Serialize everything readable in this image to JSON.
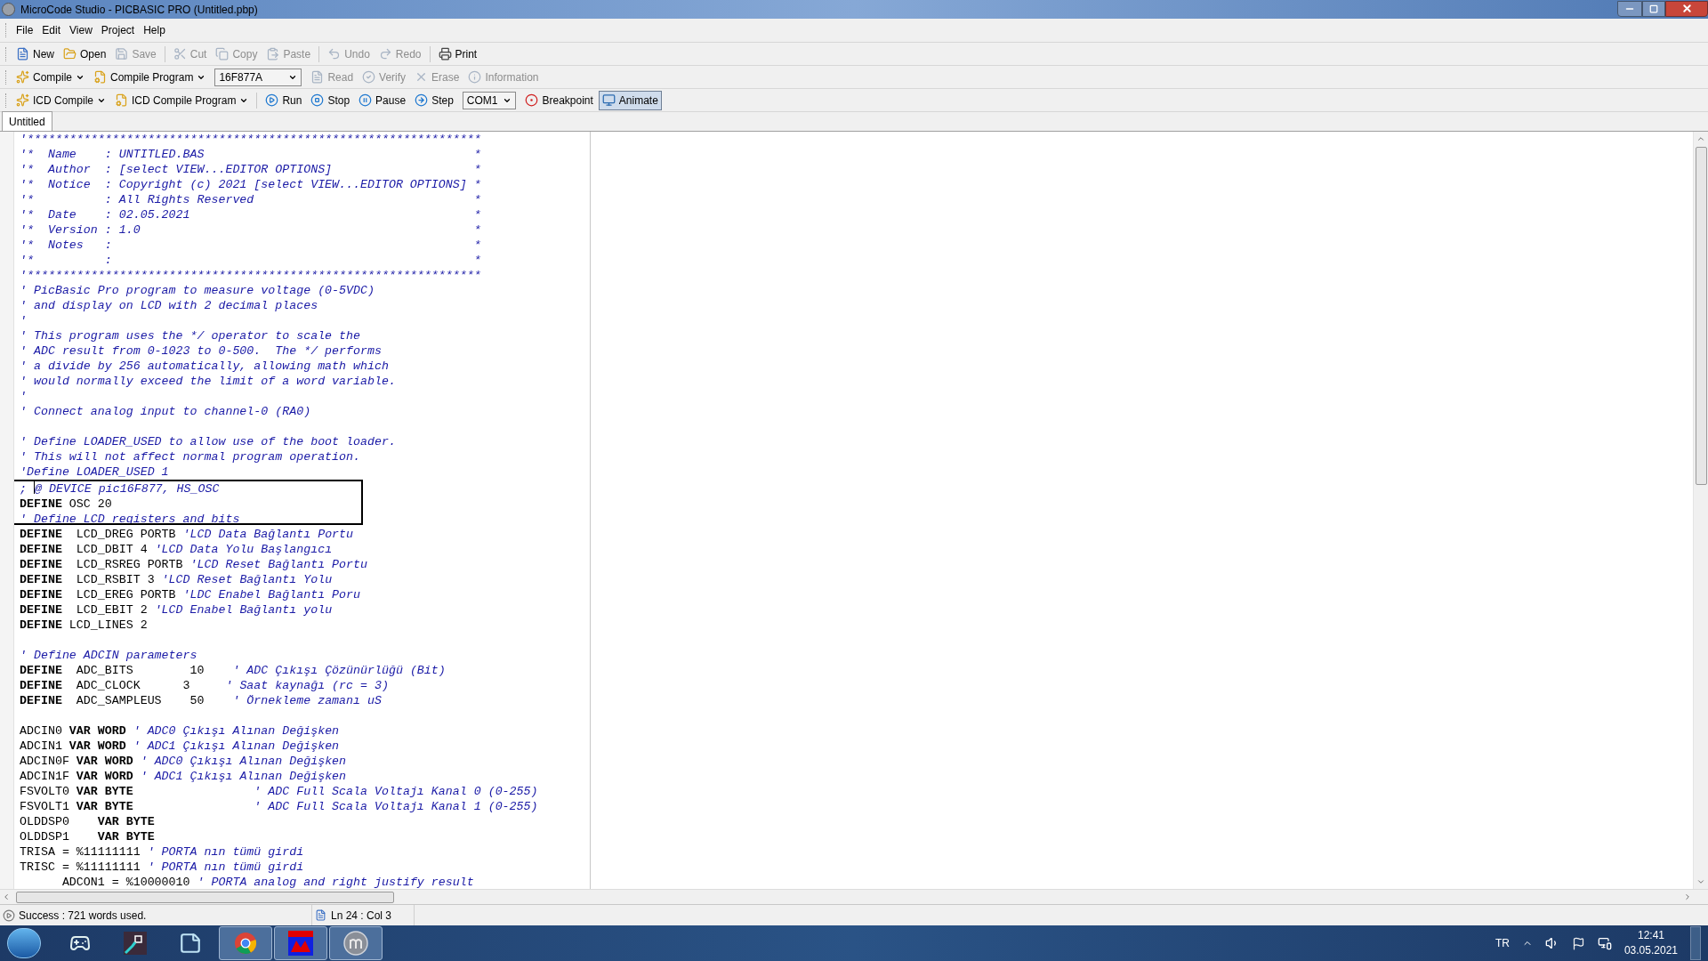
{
  "window": {
    "title": "MicroCode Studio - PICBASIC PRO (Untitled.pbp)"
  },
  "menu": [
    "File",
    "Edit",
    "View",
    "Project",
    "Help"
  ],
  "toolbar_standard": [
    {
      "kind": "button",
      "label": "New",
      "disabled": false
    },
    {
      "kind": "button",
      "label": "Open",
      "disabled": false
    },
    {
      "kind": "button",
      "label": "Save",
      "disabled": true
    },
    {
      "kind": "separator"
    },
    {
      "kind": "button",
      "label": "Cut",
      "disabled": true
    },
    {
      "kind": "button",
      "label": "Copy",
      "disabled": true
    },
    {
      "kind": "button",
      "label": "Paste",
      "disabled": true
    },
    {
      "kind": "separator"
    },
    {
      "kind": "button",
      "label": "Undo",
      "disabled": true
    },
    {
      "kind": "button",
      "label": "Redo",
      "disabled": true
    },
    {
      "kind": "separator"
    },
    {
      "kind": "button",
      "label": "Print",
      "disabled": false
    }
  ],
  "toolbar_compile": [
    {
      "kind": "button",
      "label": "Compile",
      "disabled": false,
      "dropdown": true
    },
    {
      "kind": "button",
      "label": "Compile Program",
      "disabled": false,
      "dropdown": true
    },
    {
      "kind": "combo",
      "value": "16F877A"
    },
    {
      "kind": "button",
      "label": "Read",
      "disabled": true,
      "dropdown": false
    },
    {
      "kind": "button",
      "label": "Verify",
      "disabled": true,
      "dropdown": false
    },
    {
      "kind": "button",
      "label": "Erase",
      "disabled": true,
      "dropdown": false
    },
    {
      "kind": "button",
      "label": "Information",
      "disabled": true,
      "dropdown": false
    }
  ],
  "toolbar_icd": [
    {
      "kind": "button",
      "label": "ICD Compile",
      "dropdown": true,
      "pressed": false
    },
    {
      "kind": "button",
      "label": "ICD Compile Program",
      "dropdown": true,
      "pressed": false
    },
    {
      "kind": "separator"
    },
    {
      "kind": "button",
      "label": "Run",
      "dropdown": false,
      "pressed": false
    },
    {
      "kind": "button",
      "label": "Stop",
      "dropdown": false,
      "pressed": false
    },
    {
      "kind": "button",
      "label": "Pause",
      "dropdown": false,
      "pressed": false
    },
    {
      "kind": "button",
      "label": "Step",
      "dropdown": false,
      "pressed": false
    },
    {
      "kind": "combo",
      "value": "COM1"
    },
    {
      "kind": "button",
      "label": "Breakpoint",
      "dropdown": false,
      "pressed": false
    },
    {
      "kind": "button",
      "label": "Animate",
      "dropdown": false,
      "pressed": true
    }
  ],
  "tabs": [
    {
      "label": "Untitled",
      "selected": true
    }
  ],
  "editor": {
    "lines": [
      {
        "kind": "code",
        "segments": [
          {
            "kind": "comment",
            "text": "'****************************************************************"
          }
        ]
      },
      {
        "kind": "code",
        "segments": [
          {
            "kind": "comment",
            "text": "'*  Name    : UNTITLED.BAS                                      *"
          }
        ]
      },
      {
        "kind": "code",
        "segments": [
          {
            "kind": "comment",
            "text": "'*  Author  : [select VIEW...EDITOR OPTIONS]                    *"
          }
        ]
      },
      {
        "kind": "code",
        "segments": [
          {
            "kind": "comment",
            "text": "'*  Notice  : Copyright (c) 2021 [select VIEW...EDITOR OPTIONS] *"
          }
        ]
      },
      {
        "kind": "code",
        "segments": [
          {
            "kind": "comment",
            "text": "'*          : All Rights Reserved                               *"
          }
        ]
      },
      {
        "kind": "code",
        "segments": [
          {
            "kind": "comment",
            "text": "'*  Date    : 02.05.2021                                        *"
          }
        ]
      },
      {
        "kind": "code",
        "segments": [
          {
            "kind": "comment",
            "text": "'*  Version : 1.0                                               *"
          }
        ]
      },
      {
        "kind": "code",
        "segments": [
          {
            "kind": "comment",
            "text": "'*  Notes   :                                                   *"
          }
        ]
      },
      {
        "kind": "code",
        "segments": [
          {
            "kind": "comment",
            "text": "'*          :                                                   *"
          }
        ]
      },
      {
        "kind": "code",
        "segments": [
          {
            "kind": "comment",
            "text": "'****************************************************************"
          }
        ]
      },
      {
        "kind": "code",
        "segments": [
          {
            "kind": "comment",
            "text": "' PicBasic Pro program to measure voltage (0-5VDC)"
          }
        ]
      },
      {
        "kind": "code",
        "segments": [
          {
            "kind": "comment",
            "text": "' and display on LCD with 2 decimal places"
          }
        ]
      },
      {
        "kind": "code",
        "segments": [
          {
            "kind": "comment",
            "text": "'"
          }
        ]
      },
      {
        "kind": "code",
        "segments": [
          {
            "kind": "comment",
            "text": "' This program uses the */ operator to scale the"
          }
        ]
      },
      {
        "kind": "code",
        "segments": [
          {
            "kind": "comment",
            "text": "' ADC result from 0-1023 to 0-500.  The */ performs"
          }
        ]
      },
      {
        "kind": "code",
        "segments": [
          {
            "kind": "comment",
            "text": "' a divide by 256 automatically, allowing math which"
          }
        ]
      },
      {
        "kind": "code",
        "segments": [
          {
            "kind": "comment",
            "text": "' would normally exceed the limit of a word variable."
          }
        ]
      },
      {
        "kind": "code",
        "segments": [
          {
            "kind": "comment",
            "text": "'"
          }
        ]
      },
      {
        "kind": "code",
        "segments": [
          {
            "kind": "comment",
            "text": "' Connect analog input to channel-0 (RA0)"
          }
        ]
      },
      {
        "kind": "blank"
      },
      {
        "kind": "code",
        "segments": [
          {
            "kind": "comment",
            "text": "' Define LOADER_USED to allow use of the boot loader."
          }
        ]
      },
      {
        "kind": "code",
        "segments": [
          {
            "kind": "comment",
            "text": "' This will not affect normal program operation."
          }
        ]
      },
      {
        "kind": "code",
        "segments": [
          {
            "kind": "comment",
            "text": "'Define LOADER_USED 1"
          }
        ]
      },
      {
        "kind": "code",
        "segments": [
          {
            "kind": "comment",
            "text": "; "
          },
          {
            "kind": "cursor"
          },
          {
            "kind": "comment",
            "text": "@ DEVICE pic16F877, HS_OSC"
          }
        ]
      },
      {
        "kind": "code",
        "segments": [
          {
            "kind": "keyword",
            "text": "DEFINE"
          },
          {
            "kind": "plain",
            "text": " OSC 20"
          }
        ]
      },
      {
        "kind": "code",
        "segments": [
          {
            "kind": "comment",
            "text": "' Define LCD registers and bits"
          }
        ]
      },
      {
        "kind": "code",
        "segments": [
          {
            "kind": "keyword",
            "text": "DEFINE"
          },
          {
            "kind": "plain",
            "text": "  LCD_DREG PORTB "
          },
          {
            "kind": "comment",
            "text": "'LCD Data Bağlantı Portu"
          }
        ]
      },
      {
        "kind": "code",
        "segments": [
          {
            "kind": "keyword",
            "text": "DEFINE"
          },
          {
            "kind": "plain",
            "text": "  LCD_DBIT 4 "
          },
          {
            "kind": "comment",
            "text": "'LCD Data Yolu Başlangıcı"
          }
        ]
      },
      {
        "kind": "code",
        "segments": [
          {
            "kind": "keyword",
            "text": "DEFINE"
          },
          {
            "kind": "plain",
            "text": "  LCD_RSREG PORTB "
          },
          {
            "kind": "comment",
            "text": "'LCD Reset Bağlantı Portu"
          }
        ]
      },
      {
        "kind": "code",
        "segments": [
          {
            "kind": "keyword",
            "text": "DEFINE"
          },
          {
            "kind": "plain",
            "text": "  LCD_RSBIT 3 "
          },
          {
            "kind": "comment",
            "text": "'LCD Reset Bağlantı Yolu"
          }
        ]
      },
      {
        "kind": "code",
        "segments": [
          {
            "kind": "keyword",
            "text": "DEFINE"
          },
          {
            "kind": "plain",
            "text": "  LCD_EREG PORTB "
          },
          {
            "kind": "comment",
            "text": "'LDC Enabel Bağlantı Poru"
          }
        ]
      },
      {
        "kind": "code",
        "segments": [
          {
            "kind": "keyword",
            "text": "DEFINE"
          },
          {
            "kind": "plain",
            "text": "  LCD_EBIT 2 "
          },
          {
            "kind": "comment",
            "text": "'LCD Enabel Bağlantı yolu"
          }
        ]
      },
      {
        "kind": "code",
        "segments": [
          {
            "kind": "keyword",
            "text": "DEFINE"
          },
          {
            "kind": "plain",
            "text": " LCD_LINES 2"
          }
        ]
      },
      {
        "kind": "blank"
      },
      {
        "kind": "code",
        "segments": [
          {
            "kind": "comment",
            "text": "' Define ADCIN parameters"
          }
        ]
      },
      {
        "kind": "code",
        "segments": [
          {
            "kind": "keyword",
            "text": "DEFINE"
          },
          {
            "kind": "plain",
            "text": "  ADC_BITS        10    "
          },
          {
            "kind": "comment",
            "text": "' ADC Çıkışı Çözünürlüğü (Bit)"
          }
        ]
      },
      {
        "kind": "code",
        "segments": [
          {
            "kind": "keyword",
            "text": "DEFINE"
          },
          {
            "kind": "plain",
            "text": "  ADC_CLOCK      3     "
          },
          {
            "kind": "comment",
            "text": "' Saat kaynağı (rc = 3)"
          }
        ]
      },
      {
        "kind": "code",
        "segments": [
          {
            "kind": "keyword",
            "text": "DEFINE"
          },
          {
            "kind": "plain",
            "text": "  ADC_SAMPLEUS    50    "
          },
          {
            "kind": "comment",
            "text": "' Örnekleme zamanı uS"
          }
        ]
      },
      {
        "kind": "blank"
      },
      {
        "kind": "code",
        "segments": [
          {
            "kind": "plain",
            "text": "ADCIN0 "
          },
          {
            "kind": "keyword",
            "text": "VAR WORD"
          },
          {
            "kind": "comment",
            "text": " ' ADC0 Çıkışı Alınan Değişken"
          }
        ]
      },
      {
        "kind": "code",
        "segments": [
          {
            "kind": "plain",
            "text": "ADCIN1 "
          },
          {
            "kind": "keyword",
            "text": "VAR WORD"
          },
          {
            "kind": "comment",
            "text": " ' ADC1 Çıkışı Alınan Değişken"
          }
        ]
      },
      {
        "kind": "code",
        "segments": [
          {
            "kind": "plain",
            "text": "ADCIN0F "
          },
          {
            "kind": "keyword",
            "text": "VAR WORD"
          },
          {
            "kind": "comment",
            "text": " ' ADC0 Çıkışı Alınan Değişken"
          }
        ]
      },
      {
        "kind": "code",
        "segments": [
          {
            "kind": "plain",
            "text": "ADCIN1F "
          },
          {
            "kind": "keyword",
            "text": "VAR WORD"
          },
          {
            "kind": "comment",
            "text": " ' ADC1 Çıkışı Alınan Değişken"
          }
        ]
      },
      {
        "kind": "code",
        "segments": [
          {
            "kind": "plain",
            "text": "FSVOLT0 "
          },
          {
            "kind": "keyword",
            "text": "VAR BYTE"
          },
          {
            "kind": "comment",
            "text": "                 ' ADC Full Scala Voltajı Kanal 0 (0-255)"
          }
        ]
      },
      {
        "kind": "code",
        "segments": [
          {
            "kind": "plain",
            "text": "FSVOLT1 "
          },
          {
            "kind": "keyword",
            "text": "VAR BYTE"
          },
          {
            "kind": "comment",
            "text": "                 ' ADC Full Scala Voltajı Kanal 1 (0-255)"
          }
        ]
      },
      {
        "kind": "code",
        "segments": [
          {
            "kind": "plain",
            "text": "OLDDSP0    "
          },
          {
            "kind": "keyword",
            "text": "VAR BYTE"
          }
        ]
      },
      {
        "kind": "code",
        "segments": [
          {
            "kind": "plain",
            "text": "OLDDSP1    "
          },
          {
            "kind": "keyword",
            "text": "VAR BYTE"
          }
        ]
      },
      {
        "kind": "code",
        "segments": [
          {
            "kind": "plain",
            "text": "TRISA = %11111111 "
          },
          {
            "kind": "comment",
            "text": "' PORTA nın tümü girdi"
          }
        ]
      },
      {
        "kind": "code",
        "segments": [
          {
            "kind": "plain",
            "text": "TRISC = %11111111 "
          },
          {
            "kind": "comment",
            "text": "' PORTA nın tümü girdi"
          }
        ]
      },
      {
        "kind": "code",
        "segments": [
          {
            "kind": "plain",
            "text": "      ADCON1 = %10000010 "
          },
          {
            "kind": "comment",
            "text": "' PORTA analog and right justify result"
          }
        ]
      }
    ]
  },
  "status_bar": {
    "message": "Success : 721 words used.",
    "position": "Ln 24 : Col 3"
  },
  "taskbar": {
    "apps": [
      {
        "active": false
      },
      {
        "active": false
      },
      {
        "active": false
      },
      {
        "active": true
      },
      {
        "active": true
      },
      {
        "active": true
      }
    ],
    "language": "TR",
    "time": "12:41",
    "date": "03.05.2021"
  }
}
